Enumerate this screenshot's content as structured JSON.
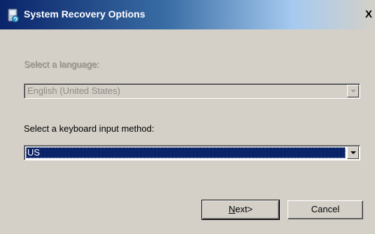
{
  "window": {
    "title": "System Recovery Options",
    "close_glyph": "X",
    "icon": "system-recovery-icon"
  },
  "language": {
    "label": "Select a language:",
    "value": "English (United States)",
    "enabled": false
  },
  "keyboard": {
    "label": "Select a keyboard input method:",
    "value": "US",
    "enabled": true
  },
  "buttons": {
    "next_underlined": "N",
    "next_rest": "ext>",
    "cancel": "Cancel"
  },
  "colors": {
    "dialog_background": "#d4d0c8",
    "titlebar_start": "#0a246a",
    "selection": "#0a246a"
  }
}
